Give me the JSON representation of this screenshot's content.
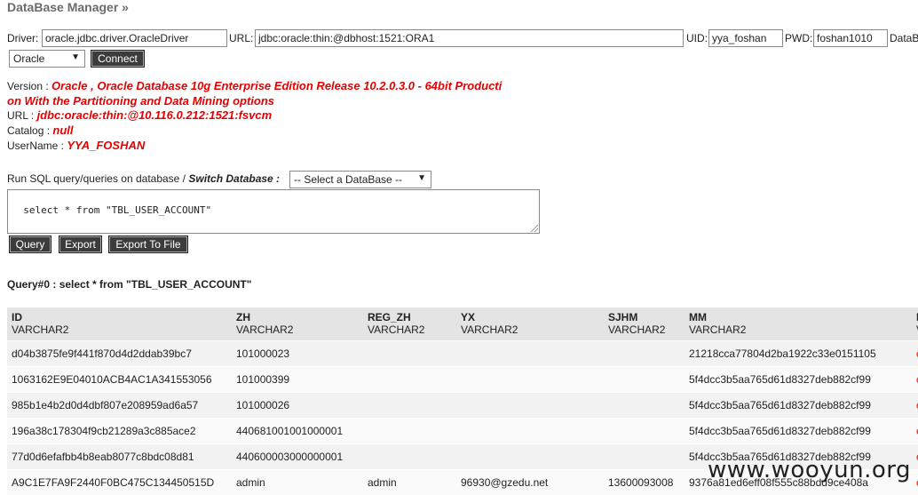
{
  "header": {
    "title": "DataBase Manager »"
  },
  "conn": {
    "driver_label": "Driver:",
    "driver_value": "oracle.jdbc.driver.OracleDriver",
    "url_label": "URL:",
    "url_value": "jdbc:oracle:thin:@dbhost:1521:ORA1",
    "uid_label": "UID:",
    "uid_value": "yya_foshan",
    "pwd_label": "PWD:",
    "pwd_value": "foshan1010",
    "db_label": "DataB",
    "dbtype_selected": "Oracle",
    "connect_label": "Connect"
  },
  "info": {
    "version_label": "Version : ",
    "version_line1": "Oracle , Oracle Database 10g Enterprise Edition Release 10.2.0.3.0 - 64bit Producti",
    "version_line2": "on With the Partitioning and Data Mining options",
    "url_label": "URL : ",
    "url_value": "jdbc:oracle:thin:@10.116.0.212:1521:fsvcm",
    "catalog_label": "Catalog : ",
    "catalog_value": "null",
    "username_label": "UserName : ",
    "username_value": "YYA_FOSHAN"
  },
  "query": {
    "run_label": "Run SQL query/queries on database / ",
    "switch_label": "Switch Database :",
    "db_select": "-- Select a DataBase --",
    "sql_text": "select * from \"TBL_USER_ACCOUNT\"",
    "query_button": "Query",
    "export_button": "Export",
    "export_file_button": "Export To File"
  },
  "result": {
    "title": "Query#0 : select * from \"TBL_USER_ACCOUNT\"",
    "columns": [
      {
        "name": "ID",
        "type": "VARCHAR2"
      },
      {
        "name": "ZH",
        "type": "VARCHAR2"
      },
      {
        "name": "REG_ZH",
        "type": "VARCHAR2"
      },
      {
        "name": "YX",
        "type": "VARCHAR2"
      },
      {
        "name": "SJHM",
        "type": "VARCHAR2"
      },
      {
        "name": "MM",
        "type": "VARCHAR2"
      },
      {
        "name": "",
        "type": ""
      }
    ],
    "rows": [
      [
        "d04b3875fe9f441f870d4d2ddab39bc7",
        "101000023",
        "",
        "",
        "",
        "21218cca77804d2ba1922c33e0151105",
        "c"
      ],
      [
        "1063162E9E04010ACB4AC1A341553056",
        "101000399",
        "",
        "",
        "",
        "5f4dcc3b5aa765d61d8327deb882cf99",
        "c"
      ],
      [
        "985b1e4b2d0d4dbf807e208959ad6a57",
        "101000026",
        "",
        "",
        "",
        "5f4dcc3b5aa765d61d8327deb882cf99",
        "c"
      ],
      [
        "196a38c178304f9cb21289a3c885ace2",
        "440681001001000001",
        "",
        "",
        "",
        "5f4dcc3b5aa765d61d8327deb882cf99",
        "c"
      ],
      [
        "77d0d6efafbb4b8eab8077c8bdc08d81",
        "440600003000000001",
        "",
        "",
        "",
        "5f4dcc3b5aa765d61d8327deb882cf99",
        "c"
      ],
      [
        "A9C1E7FA9F2440F0BC475C134450515D",
        "admin",
        "admin",
        "96930@gzedu.net",
        "13600093008",
        "9376a81ed6eff08f555c88bdd9ce408a",
        "c"
      ]
    ]
  },
  "watermark": "www.wooyun.org"
}
